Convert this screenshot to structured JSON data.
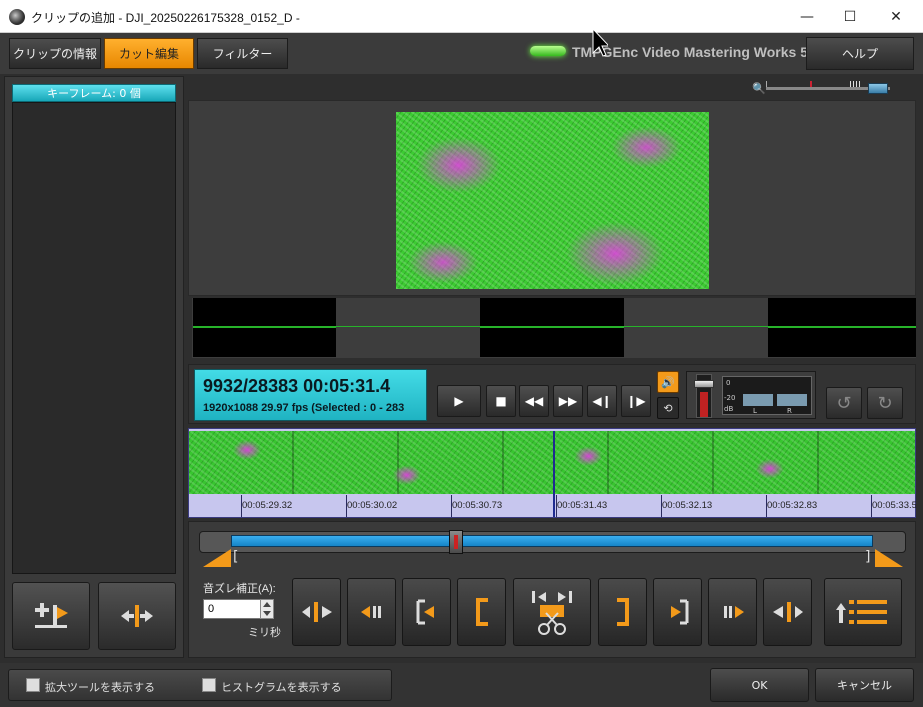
{
  "window": {
    "title": "クリップの追加 - DJI_20250226175328_0152_D -",
    "min": "—",
    "max": "☐",
    "close": "✕"
  },
  "tabs": [
    {
      "label": "クリップの情報"
    },
    {
      "label": "カット編集"
    },
    {
      "label": "フィルター"
    }
  ],
  "brand": "TMPGEnc Video Mastering Works 5",
  "help_label": "ヘルプ",
  "keyframe_header": "キーフレーム: 0 個",
  "lcd": {
    "main": "9932/28383  00:05:31.4",
    "sub": "1920x1088 29.97 fps  (Selected : 0 - 283"
  },
  "meter": {
    "scale0": "0",
    "scale20": "-20",
    "scaledb": "dB",
    "left": "L",
    "right": "R"
  },
  "timeline": {
    "ticks": [
      "00:05:29.32",
      "00:05:30.02",
      "00:05:30.73",
      "00:05:31.43",
      "00:05:32.13",
      "00:05:32.83",
      "00:05:33.5"
    ]
  },
  "audio_offset": {
    "label": "音ズレ補正(A):",
    "value": "0",
    "unit": "ミリ秒"
  },
  "checkboxes": [
    {
      "label": "拡大ツールを表示する",
      "checked": false
    },
    {
      "label": "ヒストグラムを表示する",
      "checked": false
    }
  ],
  "ok_label": "OK",
  "cancel_label": "キャンセル",
  "colors": {
    "accent": "#f39a1a",
    "lcd": "#2ec6d3",
    "active_tab": "#ffa520"
  }
}
